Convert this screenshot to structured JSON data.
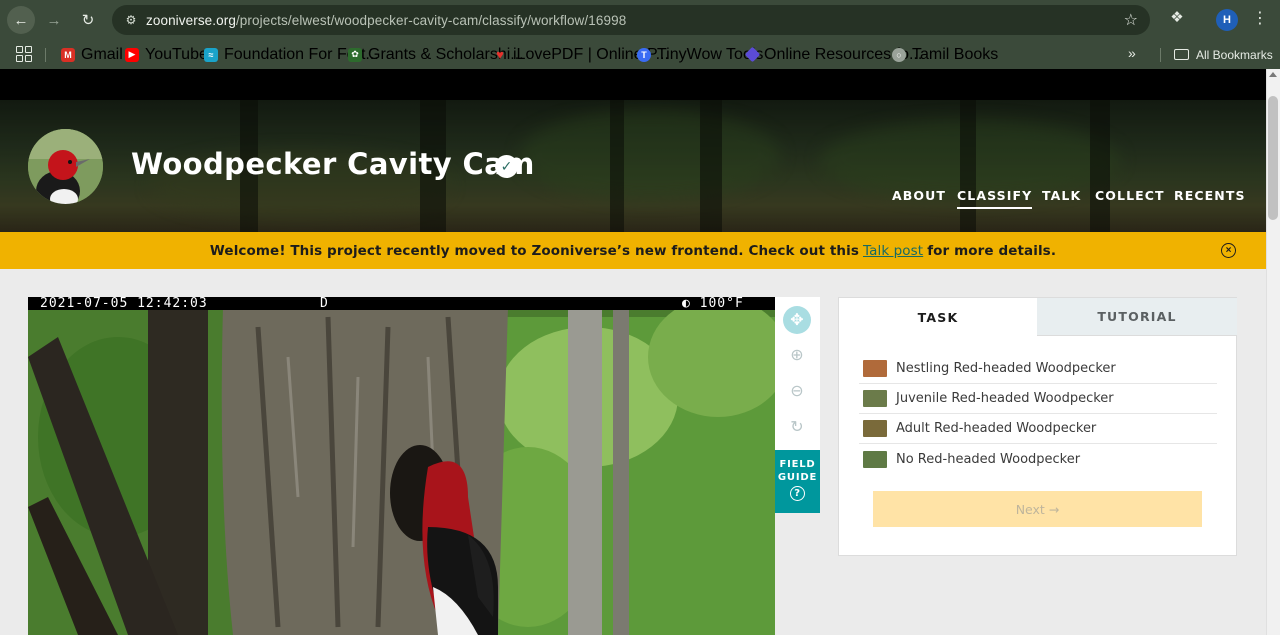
{
  "browser": {
    "url_host": "zooniverse.org",
    "url_path": "/projects/elwest/woodpecker-cavity-cam/classify/workflow/16998",
    "profile_initial": "H",
    "bookmarks": [
      {
        "label": "Gmail",
        "icon": "gmail-icon",
        "color": "#d93025"
      },
      {
        "label": "YouTube",
        "icon": "youtube-icon",
        "color": "#ff0000"
      },
      {
        "label": "Foundation For Fort...",
        "icon": "foundation-icon",
        "color": "#1aa3c9"
      },
      {
        "label": "Grants & Scholarshi...",
        "icon": "grants-icon",
        "color": "#2d6b2d"
      },
      {
        "label": "iLovePDF | Online P...",
        "icon": "ilovepdf-icon",
        "color": "#e5322d"
      },
      {
        "label": "TinyWow Tools",
        "icon": "tinywow-icon",
        "color": "#3a6cf4"
      },
      {
        "label": "Online Resources fo...",
        "icon": "resources-icon",
        "color": "#5b4bd6"
      },
      {
        "label": "Tamil Books",
        "icon": "globe-icon",
        "color": "#9aa39a"
      }
    ],
    "all_bookmarks": "All Bookmarks"
  },
  "project": {
    "title": "Woodpecker Cavity Cam",
    "nav": [
      {
        "label": "ABOUT",
        "active": false
      },
      {
        "label": "CLASSIFY",
        "active": true
      },
      {
        "label": "TALK",
        "active": false
      },
      {
        "label": "COLLECT",
        "active": false
      },
      {
        "label": "RECENTS",
        "active": false
      }
    ]
  },
  "banner": {
    "text_before": "Welcome! This project recently moved to Zooniverse’s new frontend. Check out this",
    "link": "Talk post",
    "text_after": "for more details."
  },
  "subject": {
    "timestamp": "2021-07-05 12:42:03",
    "flag": "D",
    "temperature": "◐ 100°F"
  },
  "toolbar": {
    "field_guide_line1": "FIELD",
    "field_guide_line2": "GUIDE",
    "field_guide_help": "?"
  },
  "task": {
    "tabs": [
      "TASK",
      "TUTORIAL"
    ],
    "answers": [
      {
        "label": "Nestling Red-headed Woodpecker",
        "thumb_color": "#b06a3a"
      },
      {
        "label": "Juvenile Red-headed Woodpecker",
        "thumb_color": "#6b7b4a"
      },
      {
        "label": "Adult Red-headed Woodpecker",
        "thumb_color": "#7a6a3a"
      },
      {
        "label": "No Red-headed Woodpecker",
        "thumb_color": "#5f7a45"
      }
    ],
    "next_label": "Next →"
  },
  "colors": {
    "banner": "#f0b200",
    "field_guide": "#00979d",
    "next_button": "#ffe3a6",
    "link": "#1a6a62"
  }
}
